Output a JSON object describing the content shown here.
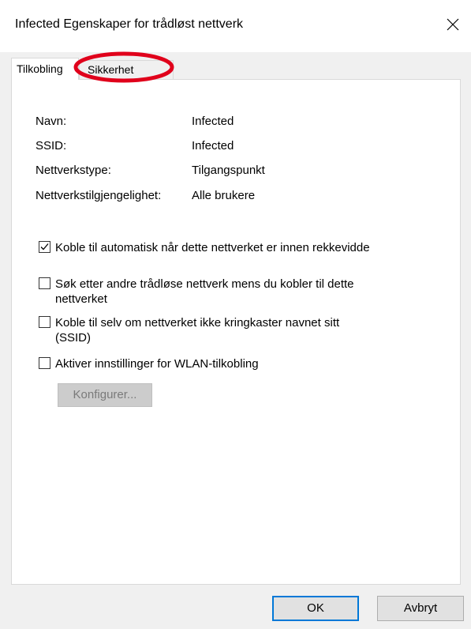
{
  "window": {
    "title": "Infected Egenskaper for trådløst nettverk",
    "close_icon": "close-icon"
  },
  "tabs": [
    {
      "label": "Tilkobling",
      "active": true
    },
    {
      "label": "Sikkerhet",
      "active": false,
      "annotated": "red-ellipse-highlight"
    }
  ],
  "properties": [
    {
      "label": "Navn:",
      "value": "Infected"
    },
    {
      "label": "SSID:",
      "value": "Infected"
    },
    {
      "label": "Nettverkstype:",
      "value": "Tilgangspunkt"
    },
    {
      "label": "Nettverkstilgjengelighet:",
      "value": "Alle brukere"
    }
  ],
  "options": [
    {
      "label_line1": "Koble til automatisk når dette nettverket er innen rekkevidde",
      "label_line2": "",
      "checked": true
    },
    {
      "label_line1": "Søk etter andre trådløse nettverk mens du kobler til dette",
      "label_line2": "nettverket",
      "checked": false
    },
    {
      "label_line1": "Koble til selv om nettverket ikke kringkaster navnet sitt",
      "label_line2": "(SSID)",
      "checked": false
    },
    {
      "label_line1": "Aktiver innstillinger for WLAN-tilkobling",
      "label_line2": "",
      "checked": false
    }
  ],
  "configure_button": {
    "label": "Konfigurer...",
    "enabled": false
  },
  "footer": {
    "ok_label": "OK",
    "cancel_label": "Avbryt"
  },
  "colors": {
    "annotation": "#e0001b",
    "accent": "#0078d7"
  }
}
